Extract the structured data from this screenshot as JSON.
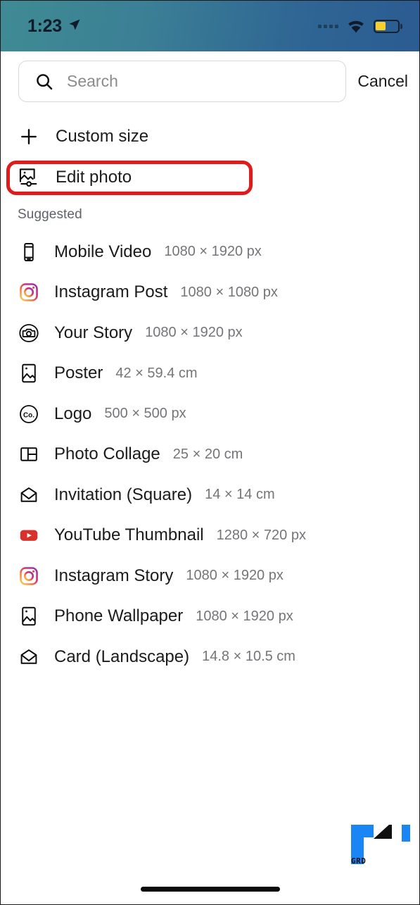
{
  "status_bar": {
    "time": "1:23",
    "location_icon": "location-arrow-icon",
    "signal_icon": "cellular-signal-icon",
    "wifi_icon": "wifi-icon",
    "battery_icon": "battery-low-power-icon",
    "battery_color": "#f7cf2e",
    "gradient_from": "#3f8b94",
    "gradient_to": "#2b5b92"
  },
  "search": {
    "placeholder": "Search",
    "value": "",
    "icon": "search-icon",
    "cancel_label": "Cancel"
  },
  "actions": [
    {
      "label": "Custom size",
      "icon": "plus-icon",
      "highlighted": false
    },
    {
      "label": "Edit photo",
      "icon": "edit-photo-icon",
      "highlighted": true
    }
  ],
  "highlight": {
    "color": "#e01b1b",
    "target": "Edit photo"
  },
  "section": {
    "title": "Suggested"
  },
  "suggested_items": [
    {
      "name": "Mobile Video",
      "dimensions": "1080 × 1920 px",
      "icon": "mobile-phone-icon"
    },
    {
      "name": "Instagram Post",
      "dimensions": "1080 × 1080 px",
      "icon": "instagram-icon"
    },
    {
      "name": "Your Story",
      "dimensions": "1080 × 1920 px",
      "icon": "story-camera-icon"
    },
    {
      "name": "Poster",
      "dimensions": "42 × 59.4 cm",
      "icon": "poster-image-icon"
    },
    {
      "name": "Logo",
      "dimensions": "500 × 500 px",
      "icon": "logo-co-icon"
    },
    {
      "name": "Photo Collage",
      "dimensions": "25 × 20 cm",
      "icon": "collage-grid-icon"
    },
    {
      "name": "Invitation (Square)",
      "dimensions": "14 × 14 cm",
      "icon": "envelope-icon"
    },
    {
      "name": "YouTube Thumbnail",
      "dimensions": "1280 × 720 px",
      "icon": "youtube-icon"
    },
    {
      "name": "Instagram Story",
      "dimensions": "1080 × 1920 px",
      "icon": "instagram-icon"
    },
    {
      "name": "Phone Wallpaper",
      "dimensions": "1080 × 1920 px",
      "icon": "poster-image-icon"
    },
    {
      "name": "Card (Landscape)",
      "dimensions": "14.8 × 10.5 cm",
      "icon": "envelope-icon"
    }
  ],
  "watermark": {
    "label": "GRD",
    "primary_color": "#1a85f5",
    "secondary_color": "#101010"
  },
  "home_indicator": {
    "present": true
  }
}
